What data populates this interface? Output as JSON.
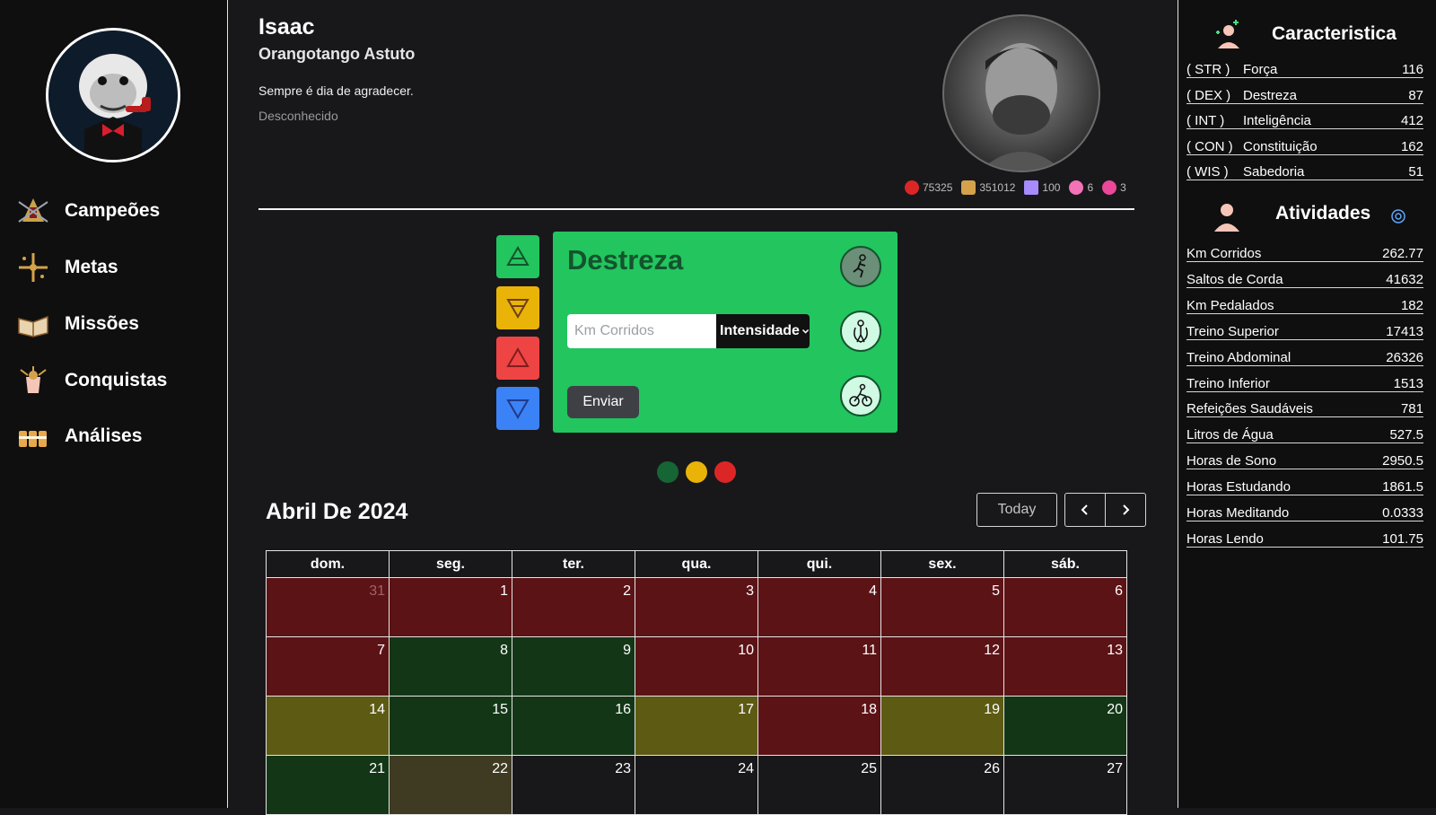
{
  "nav": [
    {
      "label": "Campeões",
      "icon": "spartan-helmet-icon"
    },
    {
      "label": "Metas",
      "icon": "target-cross-icon"
    },
    {
      "label": "Missões",
      "icon": "book-icon"
    },
    {
      "label": "Conquistas",
      "icon": "trophy-hand-icon"
    },
    {
      "label": "Análises",
      "icon": "bars-icon"
    }
  ],
  "profile": {
    "name": "Isaac",
    "title": "Orangotango Astuto",
    "quote": "Sempre é dia de agradecer.",
    "status": "Desconhecido",
    "stats": [
      {
        "value": "75325",
        "icon": "coin-icon",
        "color": "#dc2626"
      },
      {
        "value": "351012",
        "icon": "dna-icon",
        "color": "#d4a24a"
      },
      {
        "value": "100",
        "icon": "crystal-icon",
        "color": "#a78bfa"
      },
      {
        "value": "6",
        "icon": "monster-icon",
        "color": "#f472b6"
      },
      {
        "value": "3",
        "icon": "dragon-icon",
        "color": "#ec4899"
      }
    ]
  },
  "card": {
    "title": "Destreza",
    "input_placeholder": "Km Corridos",
    "select_value": "Intensidade",
    "submit_label": "Enviar",
    "activities": [
      "running-icon",
      "jump-rope-icon",
      "cycling-icon"
    ]
  },
  "calendar": {
    "title": "Abril De 2024",
    "today_label": "Today",
    "headers": [
      "dom.",
      "seg.",
      "ter.",
      "qua.",
      "qui.",
      "sex.",
      "sáb."
    ],
    "weeks": [
      [
        {
          "d": "31",
          "s": "red",
          "o": true
        },
        {
          "d": "1",
          "s": "red"
        },
        {
          "d": "2",
          "s": "red"
        },
        {
          "d": "3",
          "s": "red"
        },
        {
          "d": "4",
          "s": "red"
        },
        {
          "d": "5",
          "s": "red"
        },
        {
          "d": "6",
          "s": "red"
        }
      ],
      [
        {
          "d": "7",
          "s": "red"
        },
        {
          "d": "8",
          "s": "green"
        },
        {
          "d": "9",
          "s": "green"
        },
        {
          "d": "10",
          "s": "red"
        },
        {
          "d": "11",
          "s": "red"
        },
        {
          "d": "12",
          "s": "red"
        },
        {
          "d": "13",
          "s": "red"
        }
      ],
      [
        {
          "d": "14",
          "s": "yellow"
        },
        {
          "d": "15",
          "s": "green"
        },
        {
          "d": "16",
          "s": "green"
        },
        {
          "d": "17",
          "s": "yellow"
        },
        {
          "d": "18",
          "s": "red"
        },
        {
          "d": "19",
          "s": "yellow"
        },
        {
          "d": "20",
          "s": "green"
        }
      ],
      [
        {
          "d": "21",
          "s": "green"
        },
        {
          "d": "22",
          "s": "olive"
        },
        {
          "d": "23",
          "s": "none"
        },
        {
          "d": "24",
          "s": "none"
        },
        {
          "d": "25",
          "s": "none"
        },
        {
          "d": "26",
          "s": "none"
        },
        {
          "d": "27",
          "s": "none"
        }
      ]
    ],
    "status_colors": {
      "red": "#5c1316",
      "green": "#133716",
      "yellow": "#5d5a14",
      "olive": "#3f3a22",
      "none": "#18181b"
    }
  },
  "characteristics": {
    "title": "Caracteristica",
    "rows": [
      {
        "abbr": "( STR )",
        "name": "Força",
        "value": "116"
      },
      {
        "abbr": "( DEX )",
        "name": "Destreza",
        "value": "87"
      },
      {
        "abbr": "( INT )",
        "name": "Inteligência",
        "value": "412"
      },
      {
        "abbr": "( CON )",
        "name": "Constituição",
        "value": "162"
      },
      {
        "abbr": "( WIS )",
        "name": "Sabedoria",
        "value": "51"
      }
    ]
  },
  "activities": {
    "title": "Atividades",
    "rows": [
      {
        "name": "Km Corridos",
        "value": "262.77"
      },
      {
        "name": "Saltos de Corda",
        "value": "41632"
      },
      {
        "name": "Km Pedalados",
        "value": "182"
      },
      {
        "name": "Treino Superior",
        "value": "17413"
      },
      {
        "name": "Treino Abdominal",
        "value": "26326"
      },
      {
        "name": "Treino Inferior",
        "value": "1513"
      },
      {
        "name": "Refeições Saudáveis",
        "value": "781"
      },
      {
        "name": "Litros de Água",
        "value": "527.5"
      },
      {
        "name": "Horas de Sono",
        "value": "2950.5"
      },
      {
        "name": "Horas Estudando",
        "value": "1861.5"
      },
      {
        "name": "Horas Meditando",
        "value": "0.0333"
      },
      {
        "name": "Horas Lendo",
        "value": "101.75"
      }
    ]
  }
}
